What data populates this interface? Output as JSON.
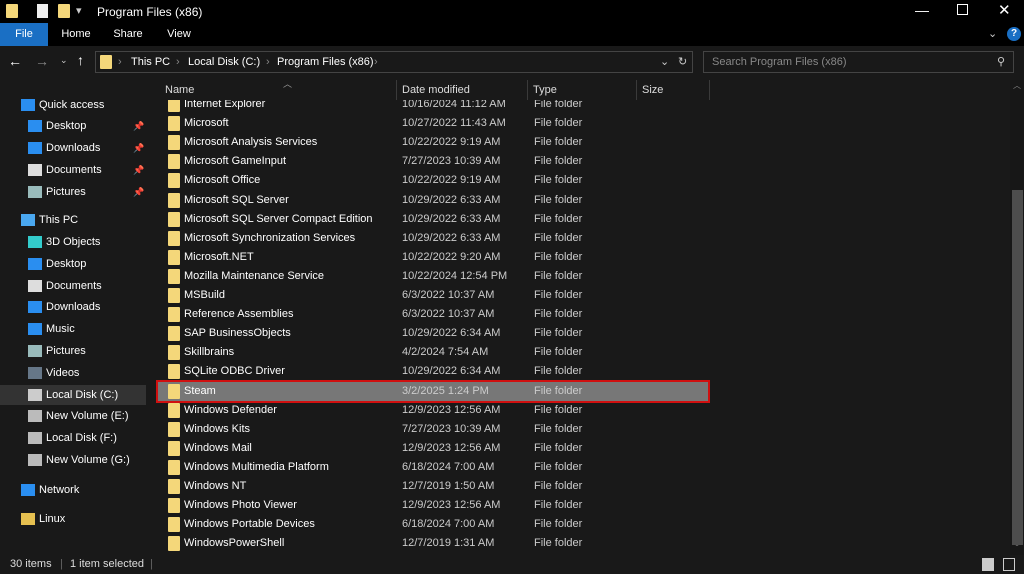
{
  "window": {
    "title": "Program Files (x86)",
    "minimize_icon": "minimize-icon",
    "maximize_icon": "maximize-icon",
    "close_icon": "close-icon"
  },
  "ribbon": {
    "tabs": [
      "File",
      "Home",
      "Share",
      "View"
    ],
    "accent": "#1a6fc4"
  },
  "address": {
    "crumbs": [
      "This PC",
      "Local Disk (C:)",
      "Program Files (x86)"
    ],
    "search_placeholder": "Search Program Files (x86)"
  },
  "sidebar": {
    "quick_access": "Quick access",
    "quick": [
      {
        "label": "Desktop",
        "icon": "desktop-icon"
      },
      {
        "label": "Downloads",
        "icon": "download-icon"
      },
      {
        "label": "Documents",
        "icon": "document-icon"
      },
      {
        "label": "Pictures",
        "icon": "pictures-icon"
      }
    ],
    "this_pc": "This PC",
    "pc": [
      {
        "label": "3D Objects"
      },
      {
        "label": "Desktop"
      },
      {
        "label": "Documents"
      },
      {
        "label": "Downloads"
      },
      {
        "label": "Music"
      },
      {
        "label": "Pictures"
      },
      {
        "label": "Videos"
      },
      {
        "label": "Local Disk (C:)",
        "selected": true
      },
      {
        "label": "New Volume (E:)"
      },
      {
        "label": "Local Disk (F:)"
      },
      {
        "label": "New Volume (G:)"
      }
    ],
    "network": "Network",
    "linux": "Linux"
  },
  "columns": [
    "Name",
    "Date modified",
    "Type",
    "Size"
  ],
  "files": [
    [
      "Internet Explorer",
      "10/16/2024 11:12 AM",
      "File folder"
    ],
    [
      "Microsoft",
      "10/27/2022 11:43 AM",
      "File folder"
    ],
    [
      "Microsoft Analysis Services",
      "10/22/2022 9:19 AM",
      "File folder"
    ],
    [
      "Microsoft GameInput",
      "7/27/2023 10:39 AM",
      "File folder"
    ],
    [
      "Microsoft Office",
      "10/22/2022 9:19 AM",
      "File folder"
    ],
    [
      "Microsoft SQL Server",
      "10/29/2022 6:33 AM",
      "File folder"
    ],
    [
      "Microsoft SQL Server Compact Edition",
      "10/29/2022 6:33 AM",
      "File folder"
    ],
    [
      "Microsoft Synchronization Services",
      "10/29/2022 6:33 AM",
      "File folder"
    ],
    [
      "Microsoft.NET",
      "10/22/2022 9:20 AM",
      "File folder"
    ],
    [
      "Mozilla Maintenance Service",
      "10/22/2024 12:54 PM",
      "File folder"
    ],
    [
      "MSBuild",
      "6/3/2022 10:37 AM",
      "File folder"
    ],
    [
      "Reference Assemblies",
      "6/3/2022 10:37 AM",
      "File folder"
    ],
    [
      "SAP BusinessObjects",
      "10/29/2022 6:34 AM",
      "File folder"
    ],
    [
      "Skillbrains",
      "4/2/2024 7:54 AM",
      "File folder"
    ],
    [
      "SQLite ODBC Driver",
      "10/29/2022 6:34 AM",
      "File folder"
    ],
    [
      "Steam",
      "3/2/2025 1:24 PM",
      "File folder"
    ],
    [
      "Windows Defender",
      "12/9/2023 12:56 AM",
      "File folder"
    ],
    [
      "Windows Kits",
      "7/27/2023 10:39 AM",
      "File folder"
    ],
    [
      "Windows Mail",
      "12/9/2023 12:56 AM",
      "File folder"
    ],
    [
      "Windows Multimedia Platform",
      "6/18/2024 7:00 AM",
      "File folder"
    ],
    [
      "Windows NT",
      "12/7/2019 1:50 AM",
      "File folder"
    ],
    [
      "Windows Photo Viewer",
      "12/9/2023 12:56 AM",
      "File folder"
    ],
    [
      "Windows Portable Devices",
      "6/18/2024 7:00 AM",
      "File folder"
    ],
    [
      "WindowsPowerShell",
      "12/7/2019 1:31 AM",
      "File folder"
    ]
  ],
  "selected_file": "Steam",
  "status": {
    "count": "30 items",
    "selected": "1 item selected"
  }
}
